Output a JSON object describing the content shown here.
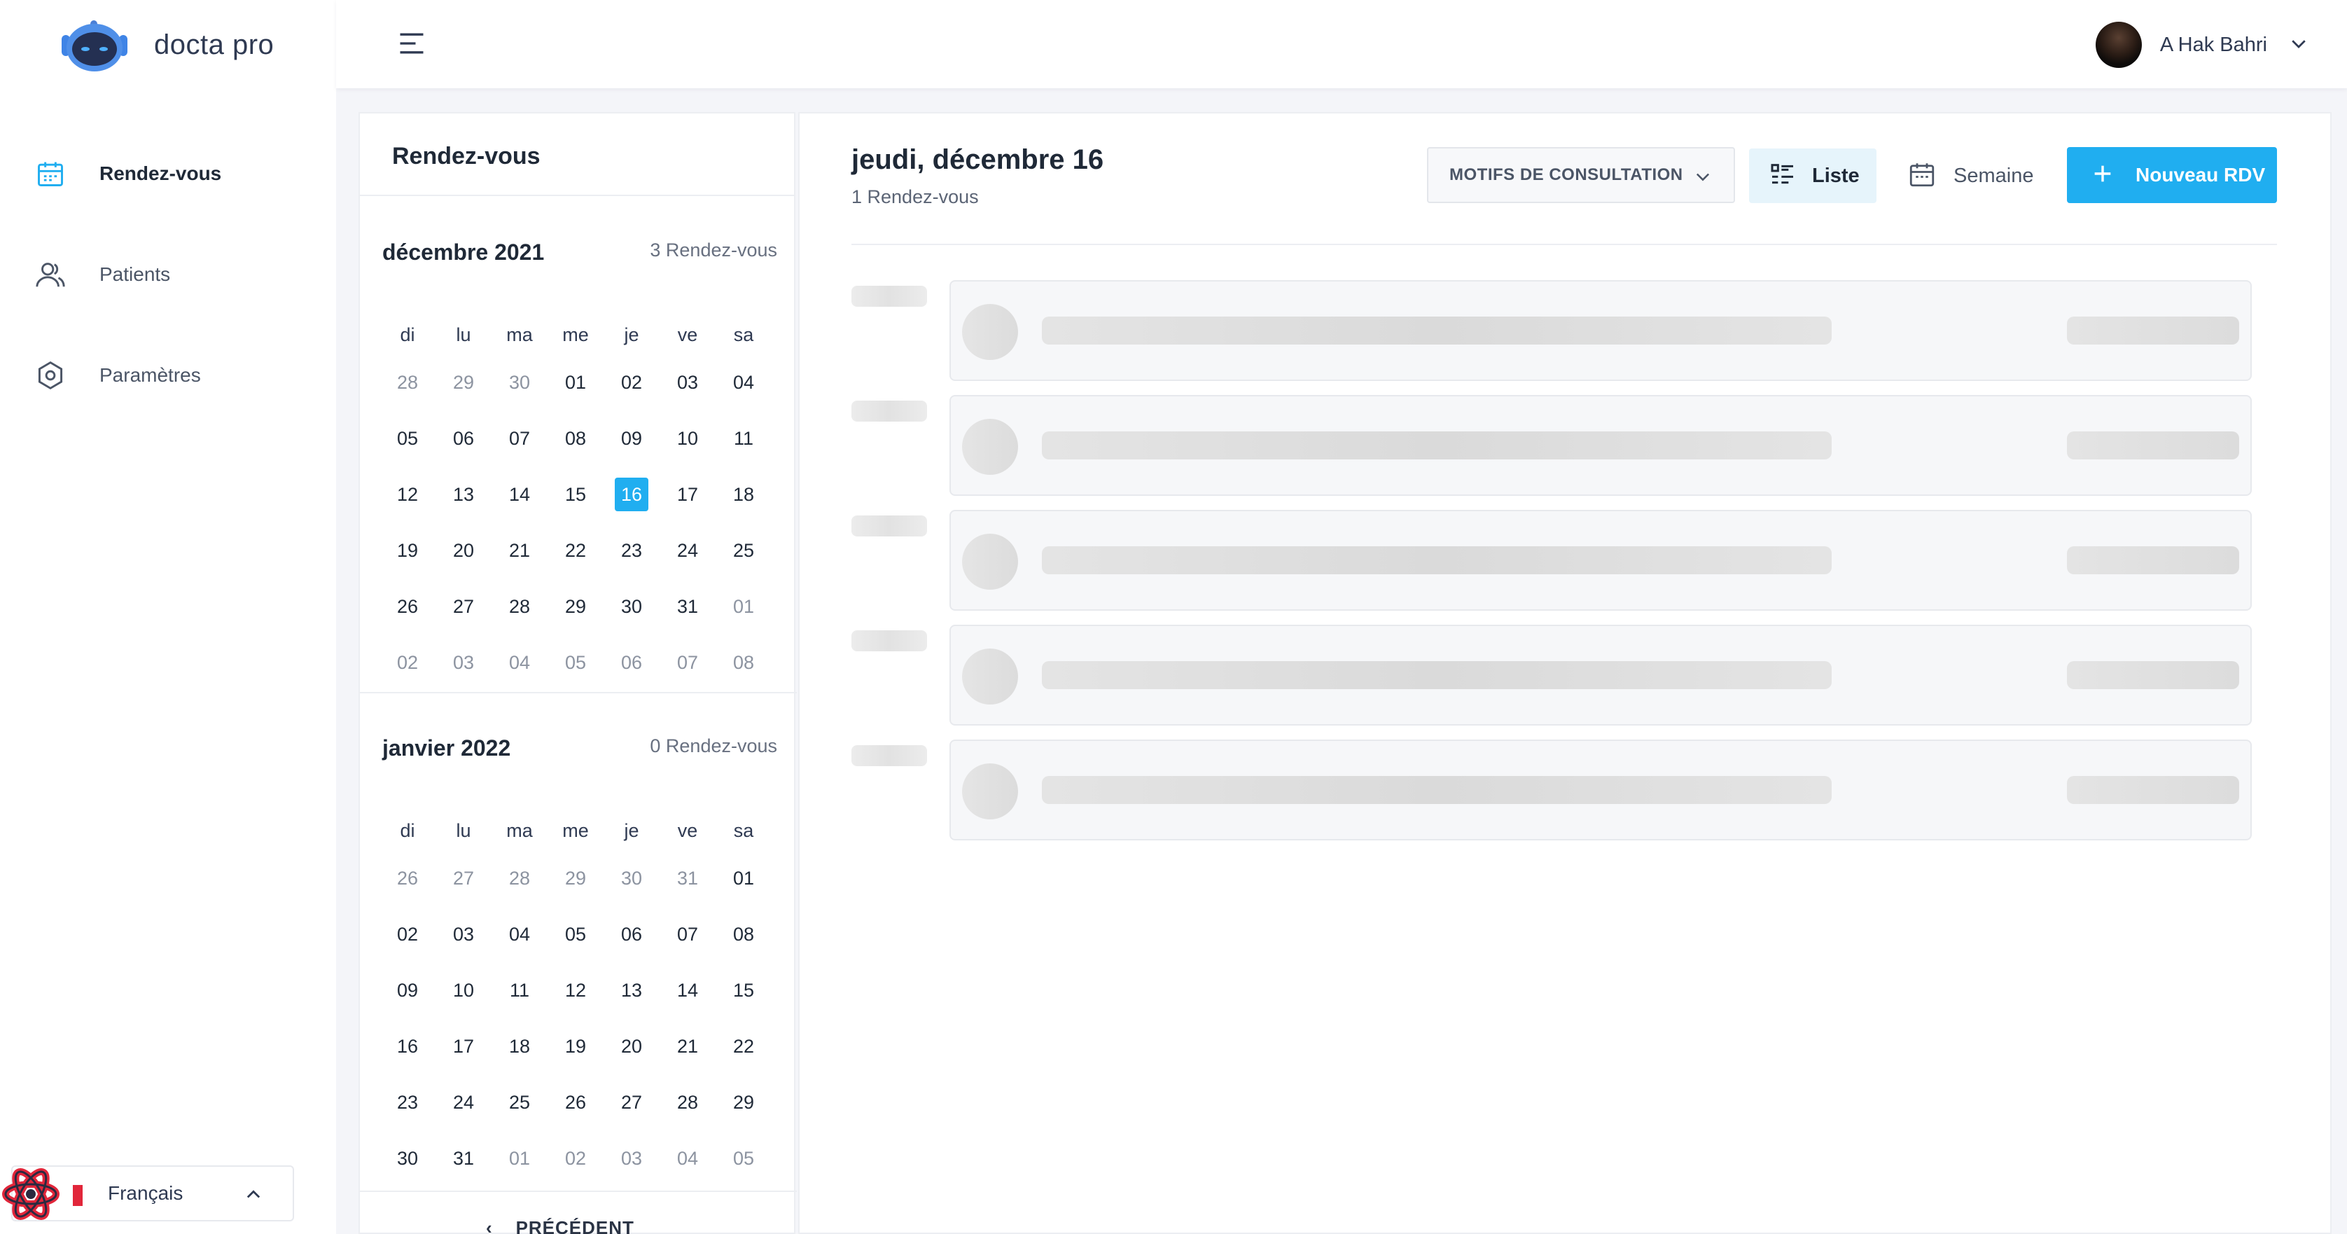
{
  "app": {
    "brand": "docta pro"
  },
  "sidebar": {
    "items": [
      {
        "label": "Rendez-vous",
        "icon": "calendar-icon",
        "active": true
      },
      {
        "label": "Patients",
        "icon": "users-icon",
        "active": false
      },
      {
        "label": "Paramètres",
        "icon": "settings-hexagon-icon",
        "active": false
      }
    ],
    "language": {
      "label": "Français",
      "icon": "chevron-up-icon"
    }
  },
  "topbar": {
    "menu_icon": "menu-icon",
    "user": {
      "name": "A Hak Bahri",
      "icon": "chevron-down-icon"
    }
  },
  "calendar": {
    "title": "Rendez-vous",
    "weekdays": [
      "di",
      "lu",
      "ma",
      "me",
      "je",
      "ve",
      "sa"
    ],
    "months": [
      {
        "title": "décembre 2021",
        "count": "3 Rendez-vous",
        "days": [
          "28",
          "29",
          "30",
          "01",
          "02",
          "03",
          "04",
          "05",
          "06",
          "07",
          "08",
          "09",
          "10",
          "11",
          "12",
          "13",
          "14",
          "15",
          "16",
          "17",
          "18",
          "19",
          "20",
          "21",
          "22",
          "23",
          "24",
          "25",
          "26",
          "27",
          "28",
          "29",
          "30",
          "31",
          "01",
          "02",
          "03",
          "04",
          "05",
          "06",
          "07",
          "08"
        ],
        "muted": [
          0,
          1,
          2,
          34,
          35,
          36,
          37,
          38,
          39,
          40,
          41
        ],
        "selected": 18
      },
      {
        "title": "janvier 2022",
        "count": "0 Rendez-vous",
        "days": [
          "26",
          "27",
          "28",
          "29",
          "30",
          "31",
          "01",
          "02",
          "03",
          "04",
          "05",
          "06",
          "07",
          "08",
          "09",
          "10",
          "11",
          "12",
          "13",
          "14",
          "15",
          "16",
          "17",
          "18",
          "19",
          "20",
          "21",
          "22",
          "23",
          "24",
          "25",
          "26",
          "27",
          "28",
          "29",
          "30",
          "31",
          "01",
          "02",
          "03",
          "04",
          "05"
        ],
        "muted": [
          0,
          1,
          2,
          3,
          4,
          5,
          37,
          38,
          39,
          40,
          41
        ],
        "selected": -1
      }
    ],
    "prev_label": "PRÉCÉDENT"
  },
  "main": {
    "date_title": "jeudi, décembre 16",
    "count": "1 Rendez-vous",
    "filter": {
      "label": "MOTIFS DE CONSULTATION",
      "icon": "chevron-down-icon"
    },
    "view_list": {
      "label": "Liste",
      "icon": "list-icon",
      "active": true
    },
    "view_week": {
      "label": "Semaine",
      "icon": "calendar-icon"
    },
    "new_button": {
      "label": "Nouveau RDV",
      "icon": "plus-icon"
    },
    "colors": {
      "accent": "#20aef0",
      "active_tab_bg": "#e6f4fb"
    }
  }
}
